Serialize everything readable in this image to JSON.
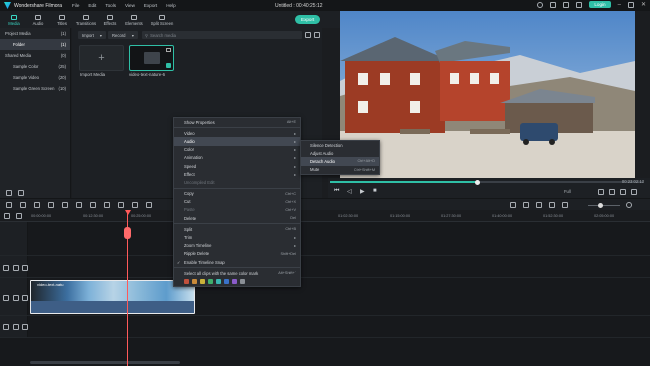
{
  "titlebar": {
    "app": "Wondershare Filmora",
    "menu": [
      "File",
      "Edit",
      "Tools",
      "View",
      "Export",
      "Help"
    ],
    "doc": "Untitled : 00:40:25:12",
    "login": "Login"
  },
  "toolbar": {
    "items": [
      "Media",
      "Audio",
      "Titles",
      "Transitions",
      "Effects",
      "Elements",
      "Split Screen"
    ],
    "export": "Export"
  },
  "sidebar": {
    "items": [
      {
        "label": "Project Media",
        "count": "(1)"
      },
      {
        "label": "Folder",
        "count": "(1)"
      },
      {
        "label": "Shared Media",
        "count": "(0)"
      },
      {
        "label": "Sample Color",
        "count": "(25)"
      },
      {
        "label": "Sample Video",
        "count": "(20)"
      },
      {
        "label": "Sample Green Screen",
        "count": "(10)"
      }
    ]
  },
  "media": {
    "import_dd": "Import",
    "record_dd": "Record",
    "search_placeholder": "Search media",
    "import_label": "Import Media",
    "clip_label": "video-text-nature-6"
  },
  "preview": {
    "timecode": "00:23:02:13",
    "quality": "Full"
  },
  "ruler": {
    "ticks": [
      "00:00:00:00",
      "00:12:30:00",
      "00:25:00:00",
      "00:37:30:00",
      "00:50:00:00",
      "01:02:30:00",
      "01:15:00:00",
      "01:27:30:00",
      "01:40:00:00",
      "01:52:30:00",
      "02:05:00:00",
      "02:17:30:00"
    ]
  },
  "timeline": {
    "clip_label": "video-text-natu"
  },
  "context_menu": {
    "items": [
      {
        "label": "Show Properties",
        "shortcut": "Alt+E",
        "disabled": false,
        "sub": false
      },
      {
        "sep": true
      },
      {
        "label": "Video",
        "shortcut": "",
        "disabled": false,
        "sub": true
      },
      {
        "label": "Audio",
        "shortcut": "",
        "disabled": false,
        "sub": true,
        "hl": true
      },
      {
        "label": "Color",
        "shortcut": "",
        "disabled": false,
        "sub": true
      },
      {
        "label": "Animation",
        "shortcut": "",
        "disabled": false,
        "sub": true
      },
      {
        "label": "Speed",
        "shortcut": "",
        "disabled": false,
        "sub": true
      },
      {
        "label": "Effect",
        "shortcut": "",
        "disabled": false,
        "sub": true
      },
      {
        "label": "Uncompiled Edit",
        "shortcut": "",
        "disabled": true,
        "sub": false
      },
      {
        "sep": true
      },
      {
        "label": "Copy",
        "shortcut": "Ctrl+C",
        "disabled": false,
        "sub": false
      },
      {
        "label": "Cut",
        "shortcut": "Ctrl+X",
        "disabled": false,
        "sub": false
      },
      {
        "label": "Paste",
        "shortcut": "Ctrl+V",
        "disabled": true,
        "sub": false
      },
      {
        "label": "Delete",
        "shortcut": "Del",
        "disabled": false,
        "sub": false
      },
      {
        "sep": true
      },
      {
        "label": "Split",
        "shortcut": "Ctrl+B",
        "disabled": false,
        "sub": false
      },
      {
        "label": "Trim",
        "shortcut": "",
        "disabled": false,
        "sub": true
      },
      {
        "label": "Zoom Timeline",
        "shortcut": "",
        "disabled": false,
        "sub": true
      },
      {
        "label": "Ripple Delete",
        "shortcut": "Shift+Del",
        "disabled": false,
        "sub": false
      },
      {
        "label": "Enable Timeline Snap",
        "shortcut": "",
        "disabled": false,
        "sub": false,
        "check": true
      },
      {
        "sep": true
      },
      {
        "label": "Select all clips with the same color mark",
        "shortcut": "Alt+Shift+`",
        "disabled": false,
        "sub": false
      }
    ],
    "color_marks": [
      "#c0503c",
      "#c98a3a",
      "#c9b23a",
      "#3fae6b",
      "#3ab6b0",
      "#3a72c9",
      "#8a5bc9",
      "#8a8f96"
    ]
  },
  "audio_submenu": {
    "items": [
      {
        "label": "Silence Detection",
        "shortcut": ""
      },
      {
        "label": "Adjust Audio",
        "shortcut": ""
      },
      {
        "label": "Detach Audio",
        "shortcut": "Ctrl+Alt+D",
        "hl": true
      },
      {
        "label": "Mute",
        "shortcut": "Ctrl+Shift+M"
      }
    ]
  },
  "colors": {
    "accent": "#2fbfa6",
    "playhead": "#ff5a5a",
    "clip": "#3a5d8f"
  }
}
